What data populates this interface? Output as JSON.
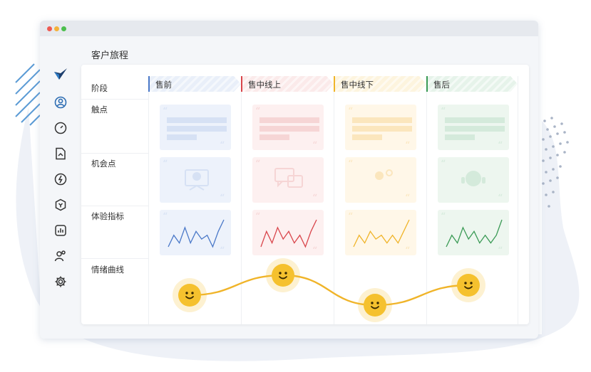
{
  "page": {
    "title": "客户旅程"
  },
  "sidebar": {
    "items": [
      {
        "icon": "logo-icon"
      },
      {
        "icon": "user-circle-icon"
      },
      {
        "icon": "dashboard-gauge-icon"
      },
      {
        "icon": "document-icon"
      },
      {
        "icon": "lightning-icon"
      },
      {
        "icon": "hexagon-icon"
      },
      {
        "icon": "bar-chart-icon"
      },
      {
        "icon": "users-icon"
      },
      {
        "icon": "gear-icon"
      }
    ]
  },
  "board": {
    "rows": [
      {
        "label": "阶段"
      },
      {
        "label": "触点"
      },
      {
        "label": "机会点"
      },
      {
        "label": "体验指标"
      },
      {
        "label": "情绪曲线"
      }
    ],
    "stages": [
      {
        "label": "售前",
        "color": "#4a78c8",
        "tint": "#e9eff9",
        "card_tint": "#edf2fb",
        "bar_tint": "#d6e1f4",
        "icon": "presentation-icon",
        "metric": [
          3,
          6,
          4,
          8,
          4,
          7,
          5,
          6,
          3,
          7,
          10
        ]
      },
      {
        "label": "售中线上",
        "color": "#d9454b",
        "tint": "#fbeaea",
        "card_tint": "#fdf0f0",
        "bar_tint": "#f6d5d5",
        "icon": "chat-bubbles-icon",
        "metric": [
          3,
          7,
          4,
          8,
          5,
          7,
          4,
          6,
          3,
          7,
          10
        ]
      },
      {
        "label": "售中线下",
        "color": "#f0b429",
        "tint": "#fdf4de",
        "card_tint": "#fff7e8",
        "bar_tint": "#fbe6bd",
        "icon": "person-group-icon",
        "metric": [
          3,
          6,
          4,
          7,
          5,
          6,
          4,
          6,
          4,
          7,
          10
        ]
      },
      {
        "label": "售后",
        "color": "#3a9a55",
        "tint": "#e6f3ea",
        "card_tint": "#edf6ef",
        "bar_tint": "#d4eadb",
        "icon": "headset-icon",
        "metric": [
          3,
          6,
          4,
          8,
          5,
          7,
          4,
          6,
          4,
          6,
          10
        ]
      }
    ],
    "emotion": {
      "values": [
        1,
        3,
        0,
        2
      ]
    }
  },
  "colors": {
    "accent_line": "#f0b429",
    "smile_face": "#f5c12e"
  }
}
